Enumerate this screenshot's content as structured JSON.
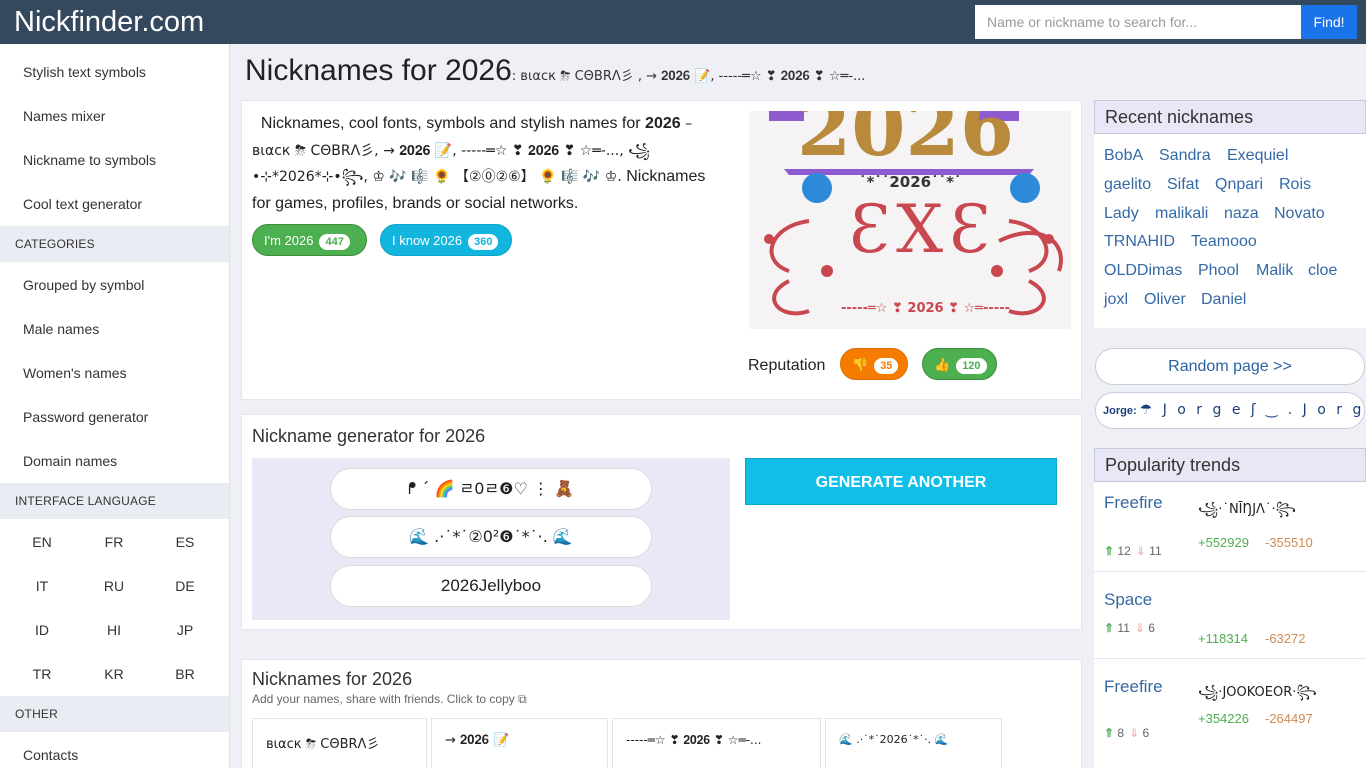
{
  "header": {
    "logo": "Nickfinder.com",
    "search_placeholder": "Name or nickname to search for...",
    "find_label": "Find!"
  },
  "sidebar": {
    "top_links": [
      "Stylish text symbols",
      "Names mixer",
      "Nickname to symbols",
      "Cool text generator"
    ],
    "categories_label": "CATEGORIES",
    "category_links": [
      "Grouped by symbol",
      "Male names",
      "Women's names",
      "Password generator",
      "Domain names"
    ],
    "interface_label": "INTERFACE LANGUAGE",
    "languages": [
      "EN",
      "FR",
      "ES",
      "IT",
      "RU",
      "DE",
      "ID",
      "HI",
      "JP",
      "TR",
      "KR",
      "BR"
    ],
    "other_label": "OTHER",
    "contacts": "Contacts"
  },
  "main": {
    "title": "Nicknames for 2026",
    "title_sub": ": вιαcк ⛈ CΘBRΛ彡 , → 𝟐𝟎𝟐𝟔 📝, -----═☆ ❣ 𝟐𝟎𝟐𝟔 ❣ ☆═-...",
    "intro": {
      "part1": "Nicknames, cool fonts, symbols and stylish names for",
      "name": "2026",
      "part2": "– вιαcк ⛈ CΘBRΛ彡, → 𝟐𝟎𝟐𝟔 📝, -----═☆ ❣ 𝟐𝟎𝟐𝟔 ❣ ☆═-..., ꧁•⊹*2026*⊹•꧂, ♔ 🎶 🎼 🌻 【②⓪②⑥】 🌻 🎼 🎶 ♔.",
      "part3": "Nicknames for games, profiles, brands or social networks."
    },
    "im_label": "I'm 2026",
    "im_count": "447",
    "know_label": "I know 2026",
    "know_count": "360",
    "reputation_label": "Reputation",
    "dislike_count": "35",
    "like_count": "120",
    "image_text": {
      "year": "2026",
      "star_line": "˙*˙˙2026˙˙*˙",
      "center": "ƐXƐ",
      "bottom": "-----═☆ ❣ 2026 ❣ ☆═-----"
    },
    "generator_title": "Nickname generator for 2026",
    "generated": [
      "ᖰ ´ 🌈 ㄹ0ㄹ❻♡ ⋮ 🧸",
      "🌊 .·˙*˙②0²❻˙*˙·. 🌊",
      "2026Jellyboo"
    ],
    "generate_label": "GENERATE ANOTHER",
    "list_title": "Nicknames for 2026",
    "list_subtitle": "Add your names, share with friends. Click to copy",
    "nick_tiles": [
      "вιαcк ⛈ CΘBRΛ彡",
      "→ 𝟐𝟎𝟐𝟔 📝",
      "-----═☆ ❣ 𝟐𝟎𝟐𝟔 ❣ ☆═-...",
      "🌊 .·˙*˙2026˙*˙·. 🌊"
    ]
  },
  "right": {
    "recent_title": "Recent nicknames",
    "recent": [
      "BobA",
      "Sandra",
      "Exequiel",
      "gaelito",
      "Sifat",
      "Qnpari",
      "Rois",
      "Lady",
      "malikali",
      "naza",
      "Novato",
      "TRNAHID",
      "Teamooo",
      "OLDDimas",
      "Phool",
      "Malik",
      "cloe",
      "joxl",
      "Oliver",
      "Daniel"
    ],
    "random_label": "Random page >>",
    "jorge_label": "Jorge:",
    "jorge_value": "☂ J o r g e ʃ ‿ . J o r g e ✿",
    "trends_title": "Popularity trends",
    "trends": [
      {
        "name": "Freefire",
        "symbol": "꧁·˙NĪŊJΛ˙·꧂",
        "up": "12",
        "down": "11",
        "plus": "+552929",
        "minus": "-355510"
      },
      {
        "name": "Space",
        "symbol": "",
        "up": "11",
        "down": "6",
        "plus": "+118314",
        "minus": "-63272"
      },
      {
        "name": "Freefire",
        "symbol": "꧁·JOOKOEOR·꧂",
        "up": "8",
        "down": "6",
        "plus": "+354226",
        "minus": "-264497"
      }
    ]
  }
}
